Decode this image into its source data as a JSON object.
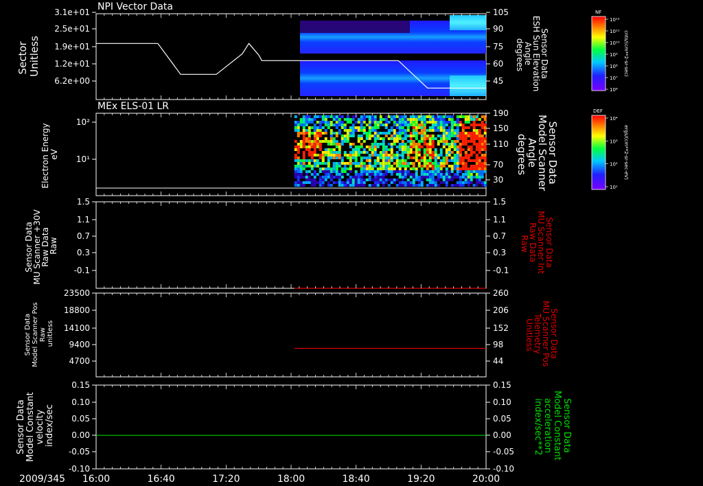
{
  "header": {
    "date": "2009/345"
  },
  "time_axis": {
    "ticks": [
      "16:00",
      "16:40",
      "17:20",
      "18:00",
      "18:40",
      "19:20",
      "20:00"
    ]
  },
  "panels": [
    {
      "title": "NPI Vector Data",
      "left_label": [
        "Sector",
        "Unitless"
      ],
      "left_ticks": [
        "3.1e+01",
        "2.5e+01",
        "1.9e+01",
        "1.2e+01",
        "6.2e+00"
      ],
      "right_ticks": [
        "105",
        "90",
        "75",
        "60",
        "45"
      ],
      "right_label": [
        "Sensor Data",
        "ESH Sun Elevation",
        "Angle",
        "degrees"
      ],
      "colorbar": {
        "title": "NF",
        "units": "cnts/(cm**2-sr-sec)",
        "ticks": [
          "10¹²",
          "10¹¹",
          "10¹⁰",
          "10⁹",
          "10⁸",
          "10⁷",
          "10⁶"
        ]
      }
    },
    {
      "title": "MEx ELS-01 LR",
      "left_label": [
        "Electron Energy",
        "eV"
      ],
      "left_ticks": [
        "10²",
        "10¹"
      ],
      "right_ticks": [
        "190",
        "150",
        "110",
        "70",
        "30"
      ],
      "right_label": [
        "Sensor Data",
        "Model Scanner",
        "Angle",
        "degrees"
      ],
      "colorbar": {
        "title": "DEF",
        "units": "ergs/(cm**2-sr-sec-eV)",
        "ticks": [
          "10⁴",
          "10³",
          "10²",
          "10¹"
        ]
      }
    },
    {
      "left_label": [
        "Sensor Data",
        "MU Scanner +30V",
        "Raw Data",
        "Raw"
      ],
      "left_ticks": [
        "1.5",
        "1.1",
        "0.7",
        "0.3",
        "-0.1"
      ],
      "right_ticks": [
        "1.5",
        "1.1",
        "0.7",
        "0.3",
        "-0.1"
      ],
      "right_label": [
        "Sensor Data",
        "MU Scanner Int",
        "Raw Data",
        "Raw"
      ]
    },
    {
      "left_label": [
        "Sensor Data",
        "Model Scanner Pos",
        "Raw",
        "unitless"
      ],
      "left_ticks": [
        "23500",
        "18800",
        "14100",
        "9400",
        "4700"
      ],
      "right_ticks": [
        "260",
        "206",
        "152",
        "98",
        "44"
      ],
      "right_label": [
        "Sensor Data",
        "MU Scanner Pos",
        "Telemetry",
        "Unitless"
      ]
    },
    {
      "left_label": [
        "Sensor Data",
        "Model Constant",
        "velocity",
        "index/sec"
      ],
      "left_ticks": [
        "0.15",
        "0.10",
        "0.05",
        "0.00",
        "-0.05",
        "-0.10"
      ],
      "right_ticks": [
        "0.15",
        "0.10",
        "0.05",
        "0.00",
        "-0.05",
        "-0.10"
      ],
      "right_label": [
        "Sensor Data",
        "Model Constant",
        "acceleration",
        "index/sec**2"
      ]
    }
  ],
  "chart_data": [
    {
      "type": "heatmap",
      "title": "NPI Vector Data",
      "x": [
        "16:00",
        "16:40",
        "17:20",
        "18:00",
        "18:40",
        "19:20",
        "20:00"
      ],
      "ylabel": "Sector Unitless",
      "ylim": [
        0,
        31
      ],
      "data_start": "18:02",
      "overlay_line": {
        "name": "Sensor Data ESH Sun Elevation Angle",
        "axis": "right",
        "ylim": [
          30,
          105
        ],
        "points": [
          [
            "16:00",
            79
          ],
          [
            "16:38",
            79
          ],
          [
            "16:52",
            52
          ],
          [
            "17:14",
            52
          ],
          [
            "17:30",
            70
          ],
          [
            "17:34",
            79
          ],
          [
            "17:40",
            69
          ],
          [
            "17:42",
            64
          ],
          [
            "19:06",
            64
          ],
          [
            "19:24",
            40
          ],
          [
            "19:42",
            40
          ],
          [
            "20:00",
            40
          ]
        ]
      }
    },
    {
      "type": "heatmap",
      "title": "MEx ELS-01 LR",
      "ylabel": "Electron Energy eV",
      "yscale": "log",
      "data_start": "18:02",
      "overlay_line": {
        "name": "Sensor Data Model Scanner Angle",
        "axis": "right",
        "ylim": [
          0,
          190
        ],
        "points": [
          [
            "16:00",
            10
          ],
          [
            "20:00",
            10
          ]
        ]
      }
    },
    {
      "type": "line",
      "ylim": [
        -0.3,
        1.5
      ],
      "series": [
        {
          "name": "Sensor Data MU Scanner Int Raw Data",
          "color": "#e00000",
          "points": [
            [
              "18:02",
              -0.3
            ],
            [
              "20:00",
              -0.3
            ]
          ]
        }
      ]
    },
    {
      "type": "line",
      "ylim": [
        0,
        23500
      ],
      "series": [
        {
          "name": "Sensor Data MU Scanner Pos Telemetry",
          "color": "#e00000",
          "points": [
            [
              "18:02",
              8000
            ],
            [
              "20:00",
              8000
            ]
          ]
        }
      ]
    },
    {
      "type": "line",
      "ylim": [
        -0.1,
        0.15
      ],
      "series": [
        {
          "name": "Sensor Data Model Constant acceleration",
          "color": "#00d000",
          "points": [
            [
              "16:00",
              0.0
            ],
            [
              "20:00",
              0.0
            ]
          ]
        }
      ]
    }
  ],
  "colors": {
    "red_label": "#e00000",
    "green_label": "#00e000",
    "axis": "#ffffff"
  }
}
